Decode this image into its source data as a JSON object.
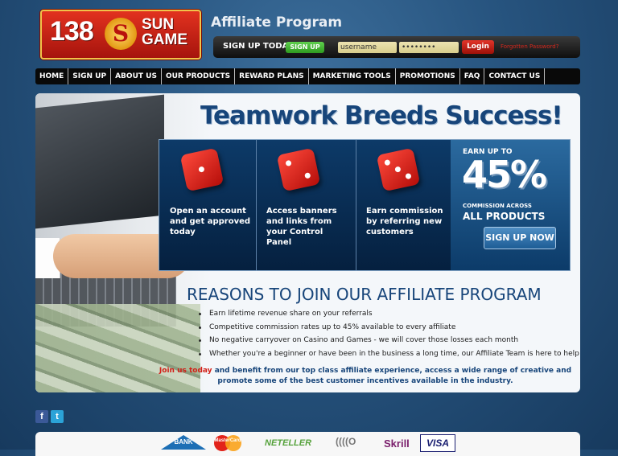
{
  "header": {
    "logo": {
      "number": "138",
      "word_top": "SUN",
      "word_bottom": "GAME",
      "emblem": "dragon-emblem"
    },
    "title": "Affiliate Program",
    "signup_label": "SIGN UP TODAY",
    "signup_button": "SIGN UP",
    "username_value": "username",
    "password_value": "••••••••",
    "login_button": "Login",
    "forgot_link": "Forgotten Password?"
  },
  "nav": {
    "items": [
      "HOME",
      "SIGN UP",
      "ABOUT US",
      "OUR PRODUCTS",
      "REWARD PLANS",
      "MARKETING TOOLS",
      "PROMOTIONS",
      "FAQ",
      "CONTACT US"
    ]
  },
  "hero": {
    "headline": "Teamwork Breeds Success!",
    "steps": [
      {
        "text": "Open an account and get approved today"
      },
      {
        "text": "Access banners and links from your Control Panel"
      },
      {
        "text": "Earn commission by referring new customers"
      }
    ],
    "promo": {
      "earn": "EARN",
      "up_to": "UP TO",
      "percent": "45%",
      "commission_across": "COMMISSION ACROSS",
      "all_products": "ALL PRODUCTS",
      "cta": "SIGN UP NOW"
    }
  },
  "reasons": {
    "title": "REASONS TO JOIN OUR AFFILIATE PROGRAM",
    "items": [
      "Earn lifetime revenue share on your referrals",
      "Competitive commission rates up to 45% available to every affiliate",
      "No negative carryover on Casino and Games - we will cover those losses each month",
      "Whether you're a beginner or have been in the business a long time, our Affiliate Team is here to help"
    ],
    "footer_link": "Join us today",
    "footer_text": " and benefit from our top class affiliate experience, access a wide range of creative and promote some of the best customer incentives available in the industry."
  },
  "social": {
    "facebook": "f",
    "twitter": "t"
  },
  "payments": {
    "bank": "BANK",
    "mastercard": "MasterCard",
    "neteller": "NETELLER",
    "ukash": "((((O",
    "skrill": "Skrill",
    "visa": "VISA"
  },
  "colors": {
    "brand_red": "#d21f17",
    "heading_blue": "#17457a",
    "signup_green": "#2e9a1f",
    "background_blue": "#27547f"
  }
}
